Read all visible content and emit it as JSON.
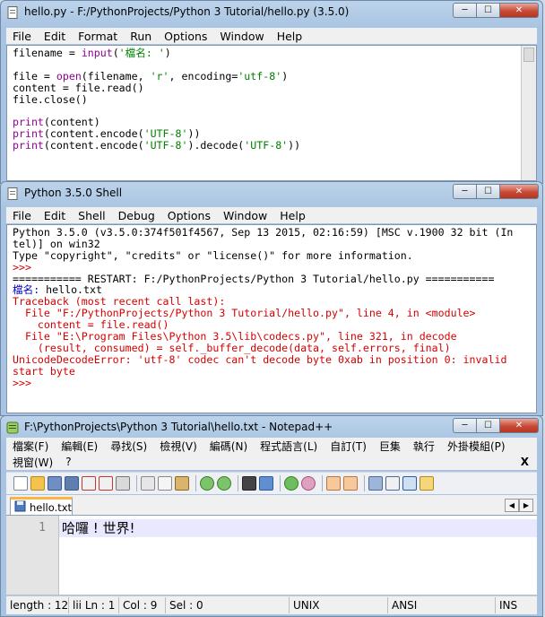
{
  "idle_editor": {
    "title": "hello.py - F:/PythonProjects/Python 3 Tutorial/hello.py (3.5.0)",
    "menu": [
      "File",
      "Edit",
      "Format",
      "Run",
      "Options",
      "Window",
      "Help"
    ],
    "code": {
      "l1_a": "filename = ",
      "l1_b": "input",
      "l1_c": "(",
      "l1_d": "'檔名: '",
      "l1_e": ")",
      "l2_a": "file = ",
      "l2_b": "open",
      "l2_c": "(filename, ",
      "l2_d": "'r'",
      "l2_e": ", encoding=",
      "l2_f": "'utf-8'",
      "l2_g": ")",
      "l3": "content = file.read()",
      "l4": "file.close()",
      "l5_a": "print",
      "l5_b": "(content)",
      "l6_a": "print",
      "l6_b": "(content.encode(",
      "l6_c": "'UTF-8'",
      "l6_d": "))",
      "l7_a": "print",
      "l7_b": "(content.encode(",
      "l7_c": "'UTF-8'",
      "l7_d": ").decode(",
      "l7_e": "'UTF-8'",
      "l7_f": "))"
    }
  },
  "shell": {
    "title": "Python 3.5.0 Shell",
    "menu": [
      "File",
      "Edit",
      "Shell",
      "Debug",
      "Options",
      "Window",
      "Help"
    ],
    "lines": {
      "l1": "Python 3.5.0 (v3.5.0:374f501f4567, Sep 13 2015, 02:16:59) [MSC v.1900 32 bit (In",
      "l2": "tel)] on win32",
      "l3": "Type \"copyright\", \"credits\" or \"license()\" for more information.",
      "l4": ">>> ",
      "l5": "=========== RESTART: F:/PythonProjects/Python 3 Tutorial/hello.py ===========",
      "l6_a": "檔名: ",
      "l6_b": "hello.txt",
      "l7": "Traceback (most recent call last):",
      "l8": "  File \"F:/PythonProjects/Python 3 Tutorial/hello.py\", line 4, in <module>",
      "l9": "    content = file.read()",
      "l10": "  File \"E:\\Program Files\\Python 3.5\\lib\\codecs.py\", line 321, in decode",
      "l11": "    (result, consumed) = self._buffer_decode(data, self.errors, final)",
      "l12": "UnicodeDecodeError: 'utf-8' codec can't decode byte 0xab in position 0: invalid",
      "l13": "start byte",
      "l14": ">>> "
    }
  },
  "notepad": {
    "title": "F:\\PythonProjects\\Python 3 Tutorial\\hello.txt - Notepad++",
    "menu_row1": [
      "檔案(F)",
      "編輯(E)",
      "尋找(S)",
      "檢視(V)",
      "編碼(N)",
      "程式語言(L)",
      "自訂(T)",
      "巨集",
      "執行",
      "外掛模組(P)"
    ],
    "menu_row2": [
      "視窗(W)",
      "?"
    ],
    "close_x": "X",
    "tab_label": "hello.txt",
    "line_number": "1",
    "content": "哈囉 ! 世界!",
    "status": {
      "length": "length : 12",
      "lines": "lii Ln : 1",
      "col": "Col : 9",
      "sel": "Sel : 0",
      "eol": "UNIX",
      "encoding": "ANSI",
      "mode": "INS"
    }
  }
}
